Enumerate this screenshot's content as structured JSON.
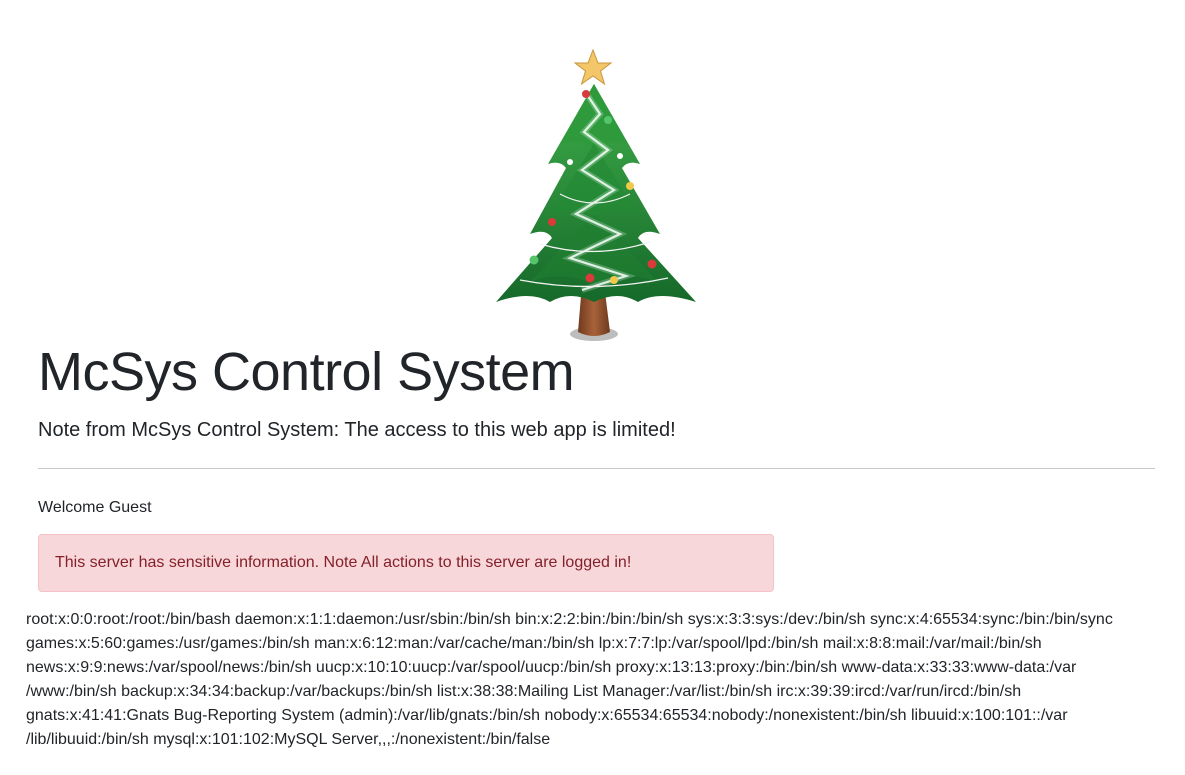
{
  "header": {
    "image_alt": "christmas-tree",
    "title": "McSys Control System",
    "lead": "Note from McSys Control System: The access to this web app is limited!"
  },
  "welcome_text": "Welcome Guest",
  "alert": {
    "text": "This server has sensitive information. Note All actions to this server are logged in!",
    "color": "#842029",
    "background": "#f8d7da"
  },
  "output_lines": [
    "root:x:0:0:root:/root:/bin/bash daemon:x:1:1:daemon:/usr/sbin:/bin/sh bin:x:2:2:bin:/bin:/bin/sh sys:x:3:3:sys:/dev:/bin/sh sync:x:4:65534:sync:/bin:/bin/sync",
    "games:x:5:60:games:/usr/games:/bin/sh man:x:6:12:man:/var/cache/man:/bin/sh lp:x:7:7:lp:/var/spool/lpd:/bin/sh mail:x:8:8:mail:/var/mail:/bin/sh",
    "news:x:9:9:news:/var/spool/news:/bin/sh uucp:x:10:10:uucp:/var/spool/uucp:/bin/sh proxy:x:13:13:proxy:/bin:/bin/sh www-data:x:33:33:www-data:/var",
    "/www:/bin/sh backup:x:34:34:backup:/var/backups:/bin/sh list:x:38:38:Mailing List Manager:/var/list:/bin/sh irc:x:39:39:ircd:/var/run/ircd:/bin/sh",
    "gnats:x:41:41:Gnats Bug-Reporting System (admin):/var/lib/gnats:/bin/sh nobody:x:65534:65534:nobody:/nonexistent:/bin/sh libuuid:x:100:101::/var",
    "/lib/libuuid:/bin/sh mysql:x:101:102:MySQL Server,,,:/nonexistent:/bin/false"
  ]
}
